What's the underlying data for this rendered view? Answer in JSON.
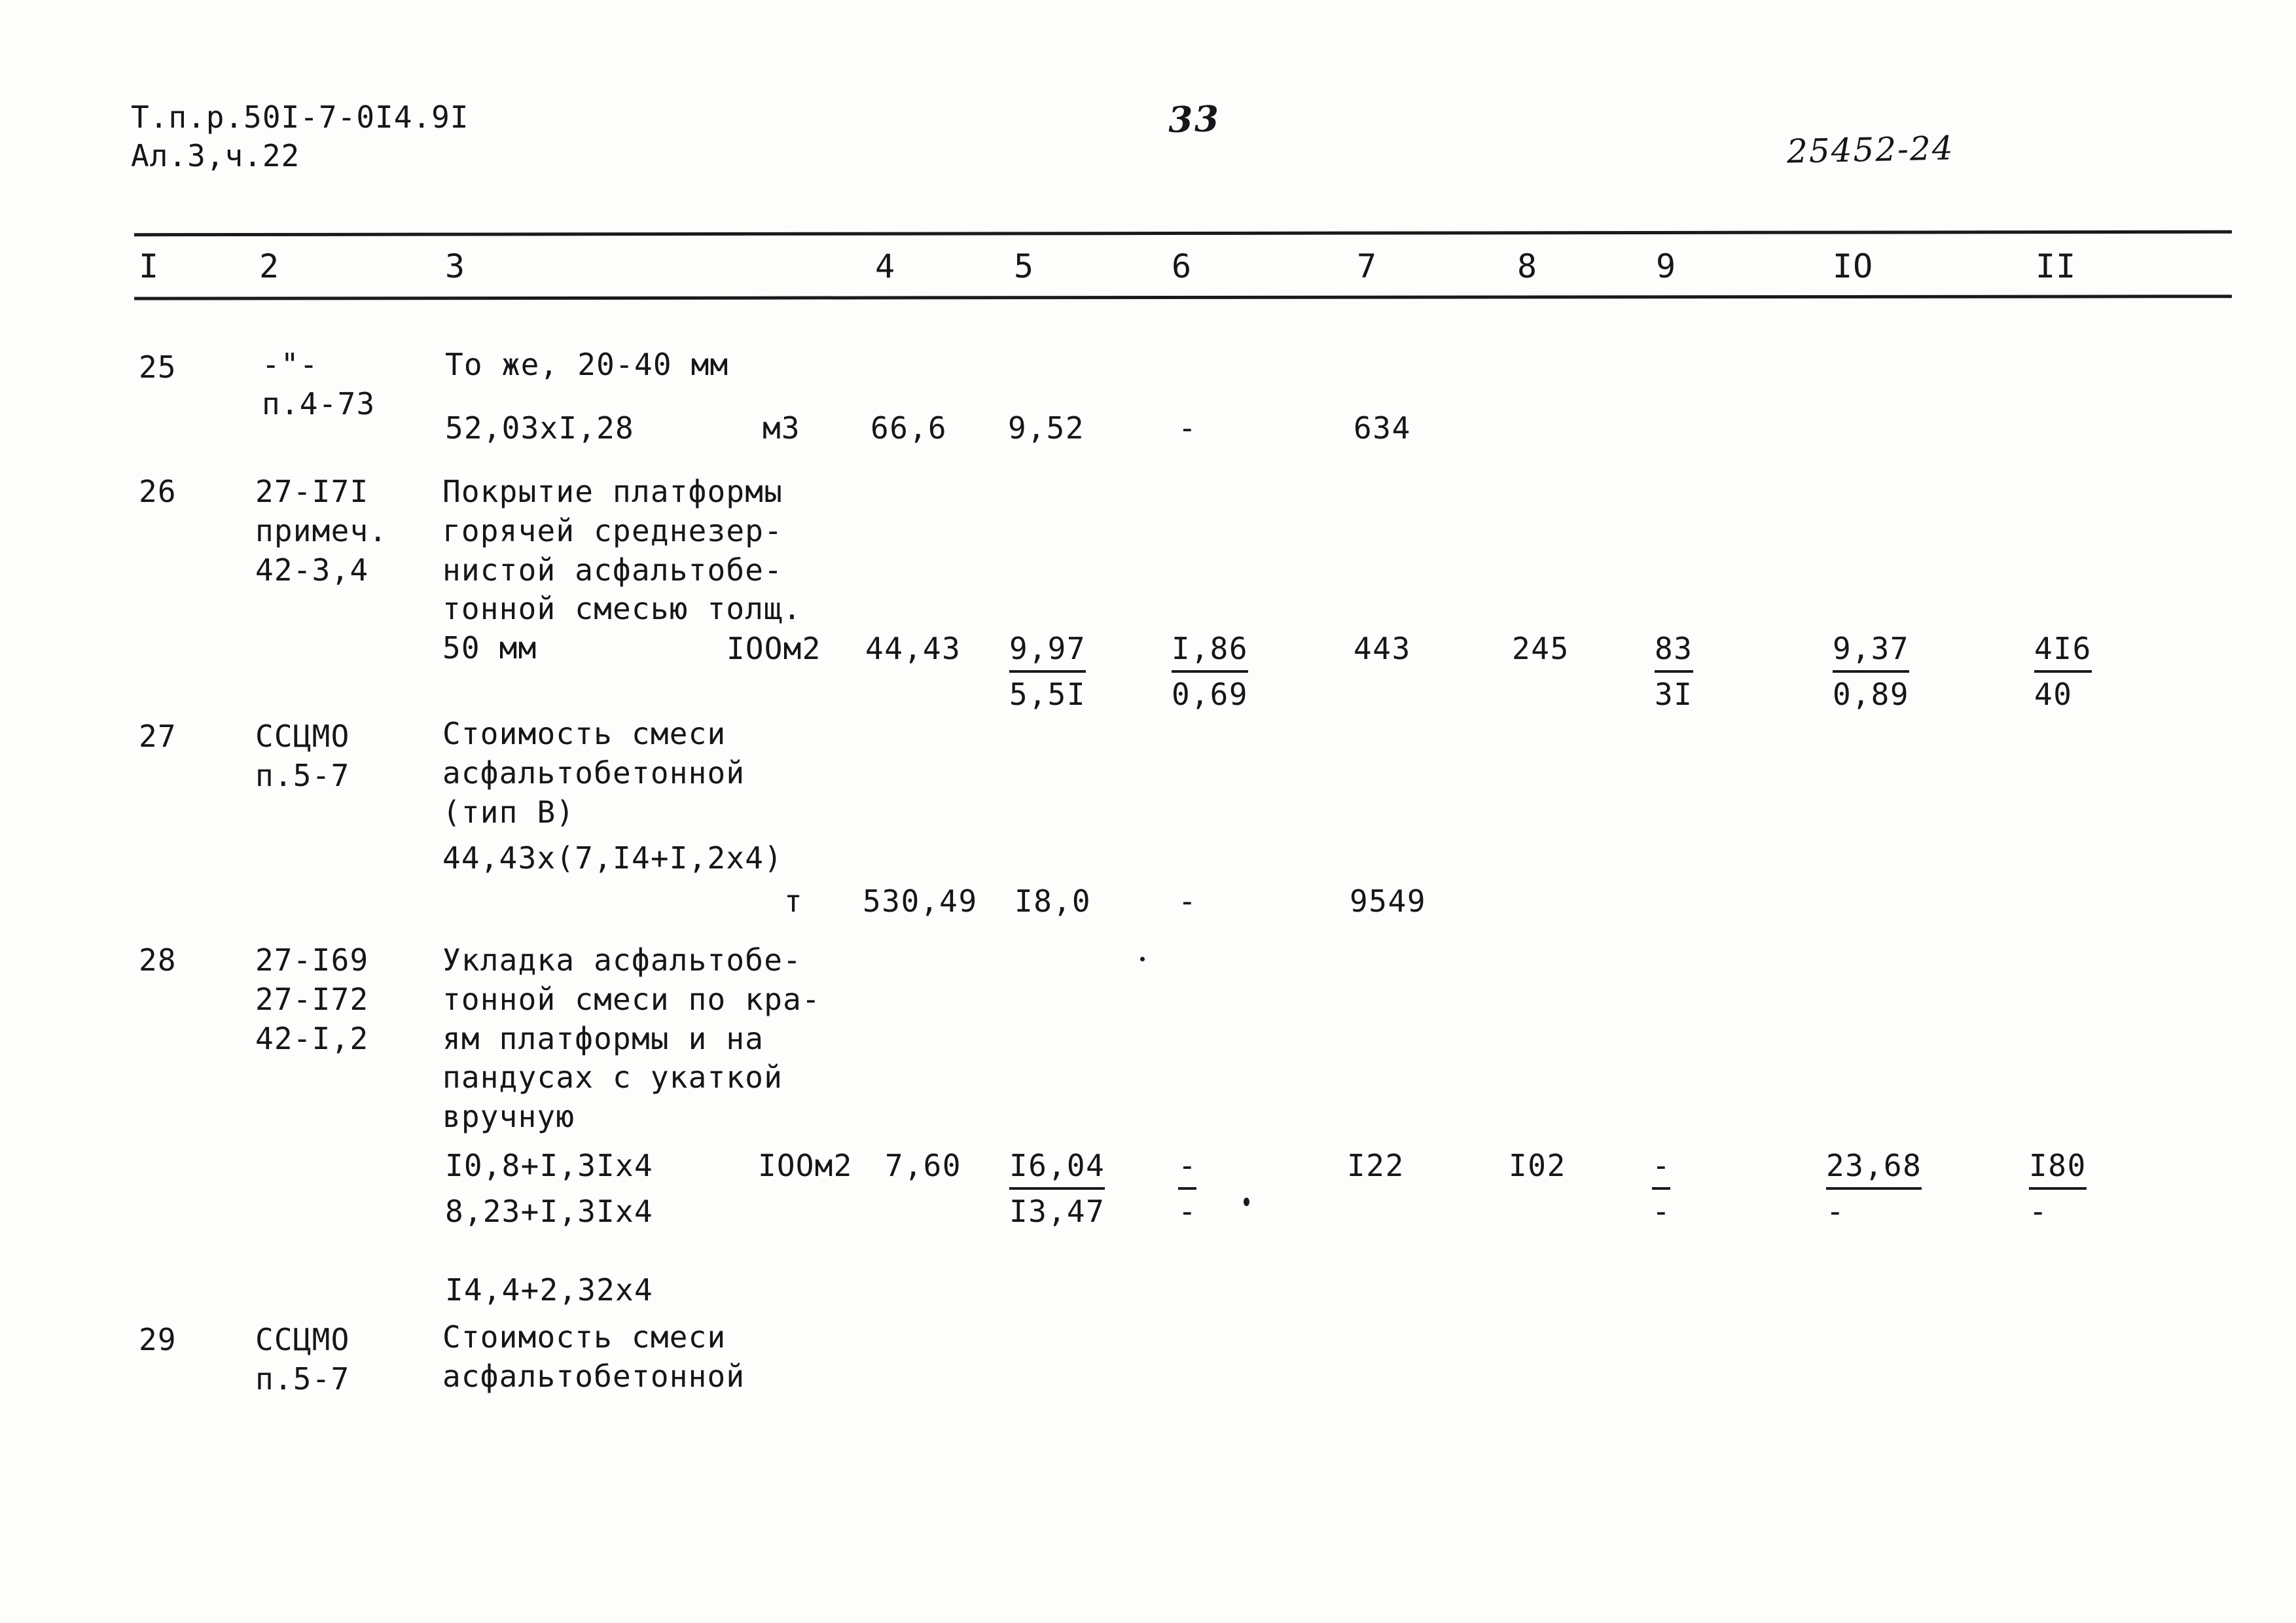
{
  "header": {
    "series_line1": "Т.п.р.50I-7-0I4.9I",
    "series_line2": "Ал.3,ч.22",
    "page_number": "33",
    "archive_code": "25452-24"
  },
  "table": {
    "column_headers": [
      "I",
      "2",
      "3",
      "4",
      "5",
      "6",
      "7",
      "8",
      "9",
      "IO",
      "II"
    ],
    "rows": [
      {
        "no": "25",
        "code_lines": [
          "-\"-",
          "п.4-73"
        ],
        "desc_lines": [
          "То же, 20-40 мм"
        ],
        "formula": "52,03xI,28",
        "unit": "м3",
        "c4": "66,6",
        "c5": "9,52",
        "c6": "-",
        "c7": "634",
        "c8": "",
        "c9": "",
        "c10": "",
        "c11": ""
      },
      {
        "no": "26",
        "code_lines": [
          "27-I7I",
          "примеч.",
          "42-3,4"
        ],
        "desc_lines": [
          "Покрытие платформы",
          "горячей среднезер-",
          "нистой асфальтобе-",
          "тонной смесью толщ.",
          "50 мм"
        ],
        "formula": "",
        "unit": "IOOм2",
        "c4": "44,43",
        "c5_top": "9,97",
        "c5_bot": "5,5I",
        "c6_top": "I,86",
        "c6_bot": "0,69",
        "c7": "443",
        "c8": "245",
        "c9_top": "83",
        "c9_bot": "3I",
        "c10_top": "9,37",
        "c10_bot": "0,89",
        "c11_top": "4I6",
        "c11_bot": "40"
      },
      {
        "no": "27",
        "code_lines": [
          "ССЦМО",
          "п.5-7"
        ],
        "desc_lines": [
          "Стоимость смеси",
          "асфальтобетонной",
          "(тип В)"
        ],
        "formula": "44,43x(7,I4+I,2x4)",
        "unit": "т",
        "c4": "530,49",
        "c5": "I8,0",
        "c6": "-",
        "c7": "9549",
        "c8": "",
        "c9": "",
        "c10": "",
        "c11": ""
      },
      {
        "no": "28",
        "code_lines": [
          "27-I69",
          "27-I72",
          "42-I,2"
        ],
        "desc_lines": [
          "Укладка асфальтобе-",
          "тонной смеси по кра-",
          "ям платформы и на",
          "пандусах с укаткой",
          "вручную"
        ],
        "formula_lines": [
          "I0,8+I,3Ix4",
          "8,23+I,3Ix4",
          "I4,4+2,32x4"
        ],
        "unit": "IOOм2",
        "c4": "7,60",
        "c5_top": "I6,04",
        "c5_bot": "I3,47",
        "c6_top": "-",
        "c6_bot": "-",
        "c7": "I22",
        "c8": "I02",
        "c9_top": "-",
        "c9_bot": "-",
        "c10_top": "23,68",
        "c10_bot": "-",
        "c11_top": "I80",
        "c11_bot": "-"
      },
      {
        "no": "29",
        "code_lines": [
          "ССЦМО",
          "п.5-7"
        ],
        "desc_lines": [
          "Стоимость смеси",
          "асфальтобетонной"
        ],
        "formula": "",
        "unit": "",
        "c4": "",
        "c5": "",
        "c6": "",
        "c7": "",
        "c8": "",
        "c9": "",
        "c10": "",
        "c11": ""
      }
    ]
  }
}
